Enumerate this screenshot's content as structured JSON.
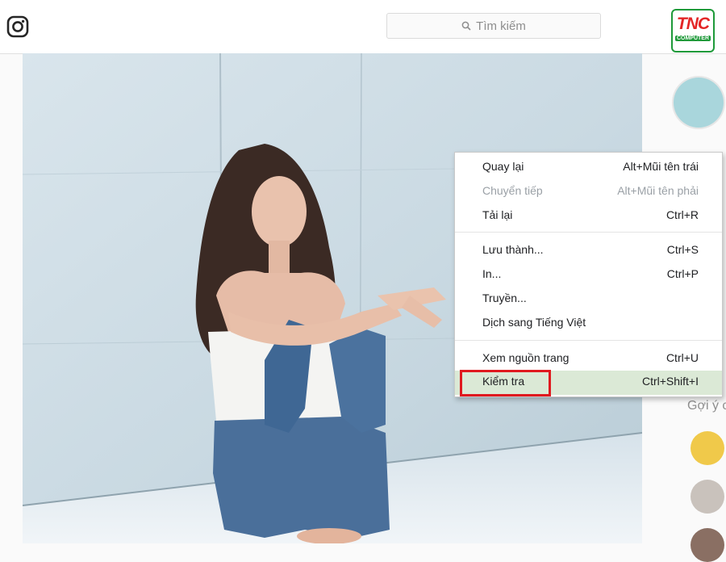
{
  "search": {
    "placeholder": "Tìm kiếm"
  },
  "branding": {
    "logo_text": "TNC",
    "logo_sub": "COMPUTER"
  },
  "sidebar": {
    "suggestions_label": "Gợi ý c"
  },
  "context_menu": {
    "items": [
      {
        "label": "Quay lại",
        "shortcut": "Alt+Mũi tên trái"
      },
      {
        "label": "Chuyển tiếp",
        "shortcut": "Alt+Mũi tên phải",
        "disabled": true
      },
      {
        "label": "Tải lại",
        "shortcut": "Ctrl+R"
      },
      {
        "label": "Lưu thành...",
        "shortcut": "Ctrl+S"
      },
      {
        "label": "In...",
        "shortcut": "Ctrl+P"
      },
      {
        "label": "Truyền...",
        "shortcut": ""
      },
      {
        "label": "Dịch sang Tiếng Việt",
        "shortcut": ""
      },
      {
        "label": "Xem nguồn trang",
        "shortcut": "Ctrl+U"
      },
      {
        "label": "Kiểm tra",
        "shortcut": "Ctrl+Shift+I",
        "highlighted": true
      }
    ]
  },
  "colors": {
    "highlight": "#dbe9d6",
    "annotation_red": "#e0191f",
    "brand_green": "#1f9a3a",
    "brand_red": "#e32626"
  }
}
